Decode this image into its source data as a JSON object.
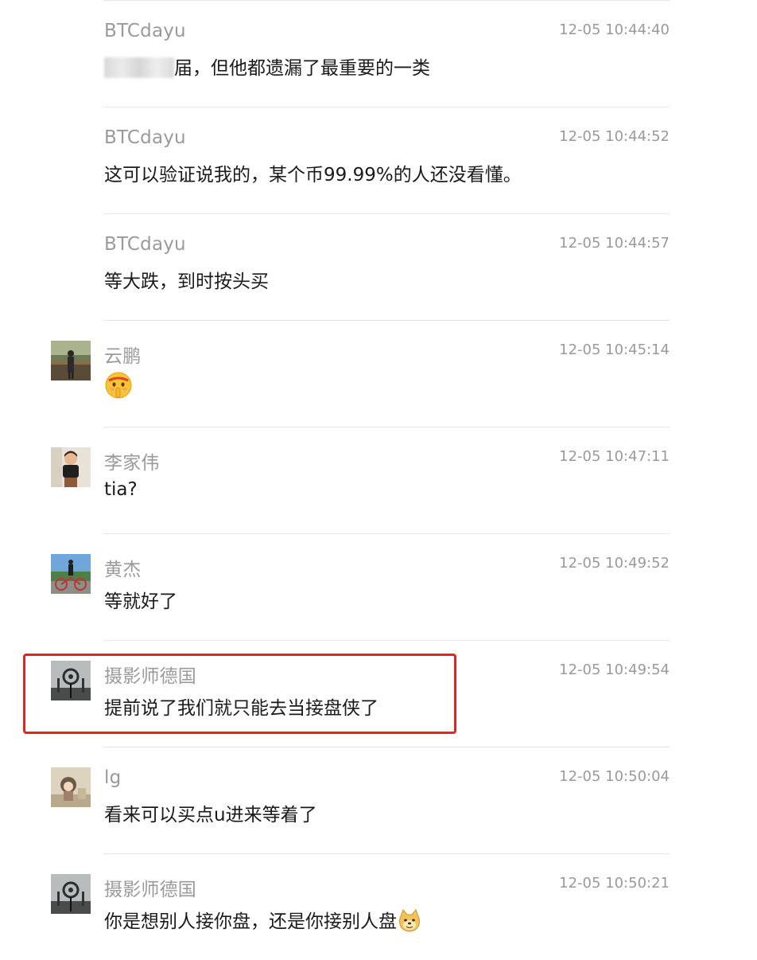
{
  "colors": {
    "name": "#9a9a9a",
    "text": "#1a1a1a",
    "divider": "#e6e6e6",
    "highlight": "#e8231d"
  },
  "messages": [
    {
      "author": "BTCdayu",
      "time": "12-05 10:44:40",
      "text": "届，但他都遗漏了最重要的一类",
      "avatar": "none",
      "redacted_prefix": true
    },
    {
      "author": "BTCdayu",
      "time": "12-05 10:44:52",
      "text": "这可以验证说我的，某个币99.99%的人还没看懂。",
      "avatar": "none"
    },
    {
      "author": "BTCdayu",
      "time": "12-05 10:44:57",
      "text": "等大跌，到时按头买",
      "avatar": "none"
    },
    {
      "author": "云鹏",
      "time": "12-05 10:45:14",
      "text": "",
      "emoji": "shushing-face-emoji",
      "avatar": "person-outdoors-photo"
    },
    {
      "author": "李家伟",
      "time": "12-05 10:47:11",
      "text": "tia?",
      "avatar": "child-photo"
    },
    {
      "author": "黄杰",
      "time": "12-05 10:49:52",
      "text": "等就好了",
      "avatar": "cyclist-photo"
    },
    {
      "author": "摄影师德国",
      "time": "12-05 10:49:54",
      "text": "提前说了我们就只能去当接盘侠了",
      "avatar": "dark-fantasy-photo",
      "highlighted": true
    },
    {
      "author": "lg",
      "time": "12-05 10:50:04",
      "text": "看来可以买点u进来等着了",
      "avatar": "cartoon-girl-photo"
    },
    {
      "author": "摄影师德国",
      "time": "12-05 10:50:21",
      "text": "你是想别人接你盘，还是你接别人盘",
      "emoji": "doge-emoji",
      "avatar": "dark-fantasy-photo"
    }
  ]
}
